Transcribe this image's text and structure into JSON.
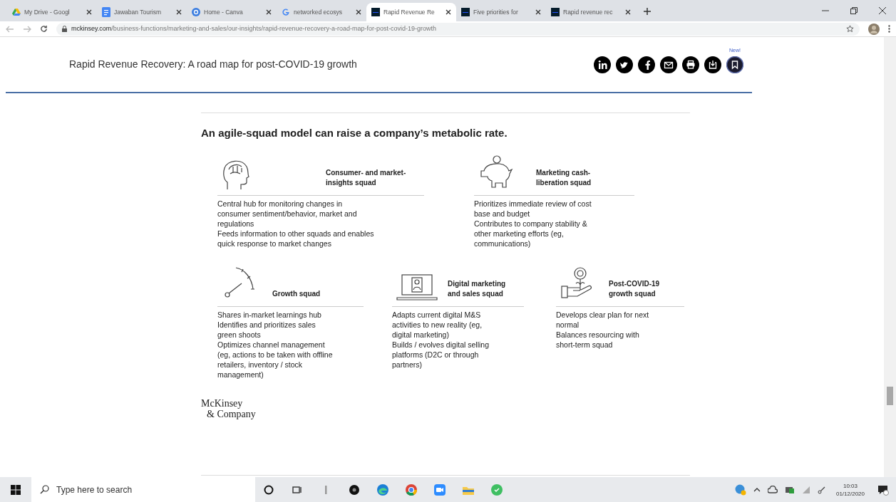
{
  "browser": {
    "tabs": [
      {
        "label": "My Drive - Googl",
        "kind": "drive",
        "selected": false
      },
      {
        "label": "Jawaban Tourism",
        "kind": "docs",
        "selected": false
      },
      {
        "label": "Home - Canva",
        "kind": "canva",
        "selected": false
      },
      {
        "label": "networked ecosys",
        "kind": "google",
        "selected": false
      },
      {
        "label": "Rapid Revenue Re",
        "kind": "mck",
        "selected": true
      },
      {
        "label": "Five priorities for",
        "kind": "mck",
        "selected": false
      },
      {
        "label": "Rapid revenue rec",
        "kind": "mck",
        "selected": false
      }
    ],
    "url_host": "mckinsey.com",
    "url_path": "/business-functions/marketing-and-sales/our-insights/rapid-revenue-recovery-a-road-map-for-post-covid-19-growth"
  },
  "page": {
    "title": "Rapid Revenue Recovery: A road map for post-COVID-19 growth",
    "new_badge": "New!",
    "exhibit": {
      "heading": "An agile-squad model can raise a company’s metabolic rate.",
      "top_squads": [
        {
          "kind": "brain",
          "title": "Consumer- and market-insights squad",
          "lines": [
            "Central hub for monitoring changes in consumer sentiment/behavior, market and regulations",
            "Feeds information to other squads and enables quick response to market changes"
          ]
        },
        {
          "kind": "piggy",
          "title": "Marketing cash-liberation squad",
          "lines": [
            "Prioritizes immediate review of cost base and budget",
            "Contributes to company stability & other marketing efforts (eg, communications)"
          ]
        }
      ],
      "bottom_squads": [
        {
          "kind": "gauge",
          "title": "Growth squad",
          "lines": [
            "Shares in-market learnings hub",
            "Identifies and prioritizes sales green shoots",
            "Optimizes channel management (eg, actions to be taken with offline retailers, inventory / stock management)"
          ]
        },
        {
          "kind": "laptop",
          "title": "Digital marketing and sales squad",
          "lines": [
            "Adapts current digital M&S activities to new reality (eg, digital marketing)",
            "Builds / evolves digital selling platforms (D2C or through partners)"
          ]
        },
        {
          "kind": "plant",
          "title": "Post-COVID-19 growth squad",
          "lines": [
            "Develops clear plan for next normal",
            "Balances resourcing with short-term squad"
          ]
        }
      ],
      "logo_line_1": "McKinsey",
      "logo_line_2": "& Company"
    }
  },
  "taskbar": {
    "search_placeholder": "Type here to search",
    "time": "10:03",
    "date": "01/12/2020"
  }
}
